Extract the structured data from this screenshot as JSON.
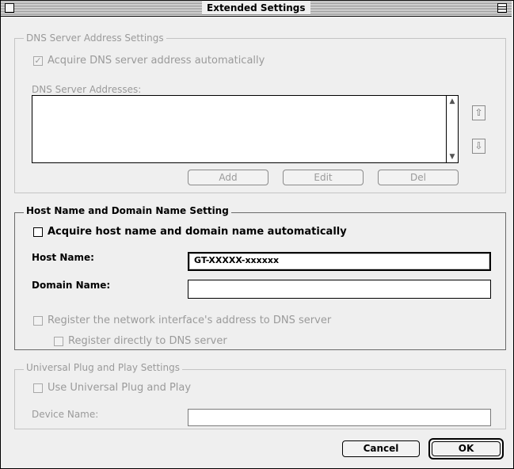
{
  "window": {
    "title": "Extended Settings"
  },
  "dns": {
    "group_title": "DNS Server Address Settings",
    "auto_label": "Acquire DNS server address automatically",
    "auto_checked": true,
    "list_label": "DNS Server Addresses:",
    "addresses": [],
    "add_label": "Add",
    "edit_label": "Edit",
    "del_label": "Del"
  },
  "host": {
    "group_title": "Host Name and Domain Name Setting",
    "auto_label": "Acquire host name and domain name automatically",
    "auto_checked": false,
    "host_label": "Host Name:",
    "host_value": "GT-XXXXX-xxxxxx",
    "domain_label": "Domain Name:",
    "domain_value": "",
    "register_label": "Register the network interface's address to DNS server",
    "register_direct_label": "Register directly to DNS server"
  },
  "upnp": {
    "group_title": "Universal Plug and Play Settings",
    "use_label": "Use Universal Plug and Play",
    "device_label": "Device Name:",
    "device_value": ""
  },
  "footer": {
    "cancel_label": "Cancel",
    "ok_label": "OK"
  },
  "icons": {
    "move_up": "arrow-up-icon",
    "move_down": "arrow-down-icon",
    "scroll_up": "scroll-up-icon",
    "scroll_down": "scroll-down-icon",
    "check": "checkmark-icon"
  }
}
